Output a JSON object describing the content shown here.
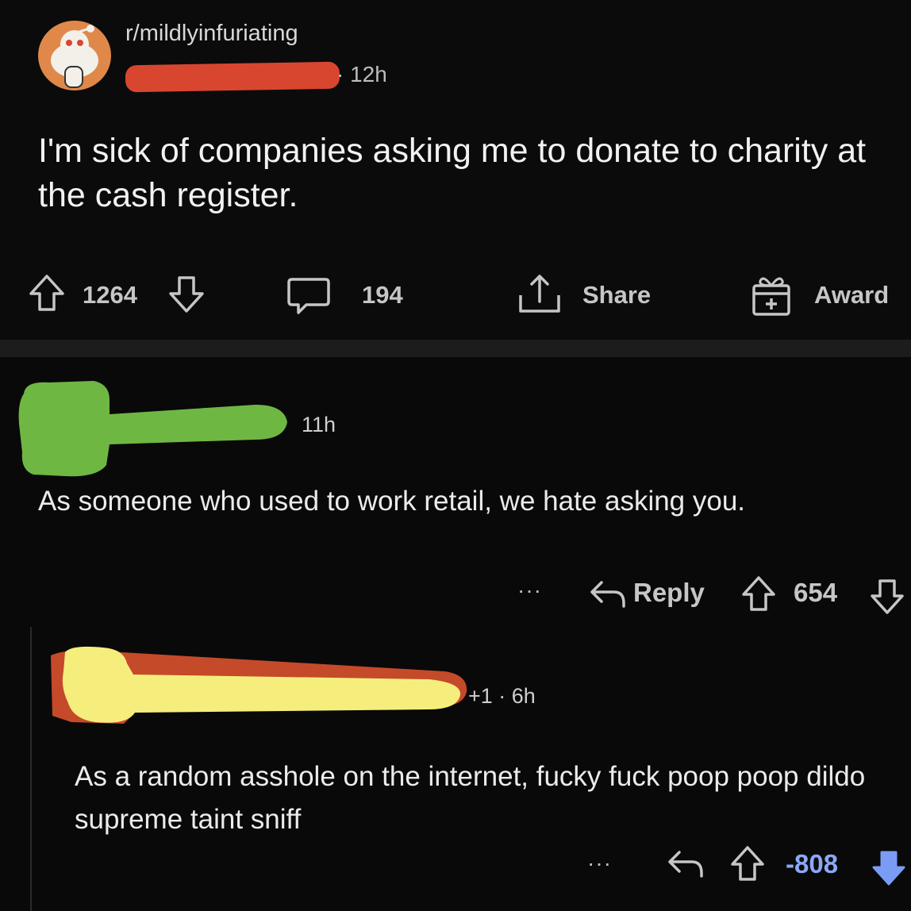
{
  "post": {
    "subreddit": "r/mildlyinfuriating",
    "time": "· 12h",
    "title": "I'm sick of companies asking me to donate to charity at the cash register.",
    "votes": "1264",
    "comments": "194",
    "share_label": "Share",
    "award_label": "Award"
  },
  "comments": [
    {
      "time": "11h",
      "body": "As someone who used to work retail, we hate asking you.",
      "more": "···",
      "reply_label": "Reply",
      "votes": "654"
    },
    {
      "meta": "+1 · 6h",
      "body": "As a random asshole on the internet, fucky fuck poop poop dildo supreme taint sniff",
      "more": "···",
      "votes": "-808",
      "downvote_color": "#7a9cf5"
    }
  ],
  "colors": {
    "background": "#080808",
    "avatar": "#e0884a",
    "redact_username_post": "#d9462f",
    "redact_username_comment1": "#6fb743",
    "redact_username_comment2": "#f5ee7c"
  }
}
